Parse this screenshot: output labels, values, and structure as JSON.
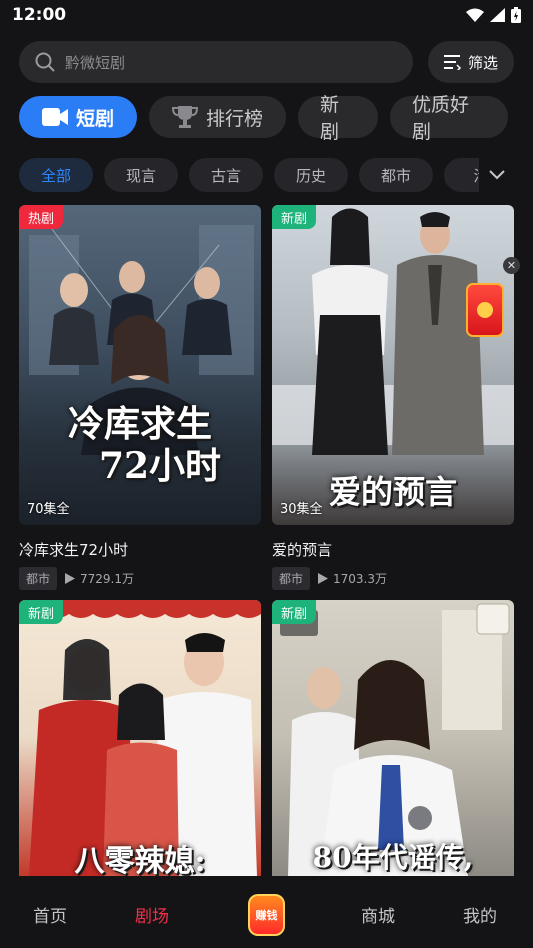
{
  "status_bar": {
    "time": "12:00"
  },
  "search": {
    "placeholder": "黔微短剧"
  },
  "filter": {
    "label": "筛选"
  },
  "tabs": [
    {
      "label": "短剧",
      "icon": "video-camera-icon",
      "active": true
    },
    {
      "label": "排行榜",
      "icon": "trophy-icon",
      "active": false
    },
    {
      "label": "新剧",
      "active": false
    },
    {
      "label": "优质好剧",
      "active": false
    }
  ],
  "genres": [
    {
      "label": "全部",
      "active": true
    },
    {
      "label": "现言"
    },
    {
      "label": "古言"
    },
    {
      "label": "历史"
    },
    {
      "label": "都市"
    },
    {
      "label": "活"
    }
  ],
  "cards": [
    {
      "badge": "热剧",
      "badge_type": "hot",
      "episodes": "70集全",
      "poster_text_line1": "冷库求生",
      "poster_text_line2": "72小时",
      "title": "冷库求生72小时",
      "tag": "都市",
      "plays": "7729.1万"
    },
    {
      "badge": "新剧",
      "badge_type": "new",
      "episodes": "30集全",
      "poster_text_line1": "爱的预言",
      "title": "爱的预言",
      "tag": "都市",
      "plays": "1703.3万"
    },
    {
      "badge": "新剧",
      "badge_type": "new",
      "poster_text_line1": "八零辣媳:"
    },
    {
      "badge": "新剧",
      "badge_type": "new",
      "poster_text_line1": "80年代谣传,"
    }
  ],
  "bottom_nav": {
    "home": "首页",
    "theater": "剧场",
    "earn": "赚钱",
    "mall": "商城",
    "mine": "我的"
  },
  "colors": {
    "accent_blue": "#2a7df5",
    "active_red": "#f0304a",
    "hot_badge": "#f0283c",
    "new_badge": "#1db37a"
  }
}
